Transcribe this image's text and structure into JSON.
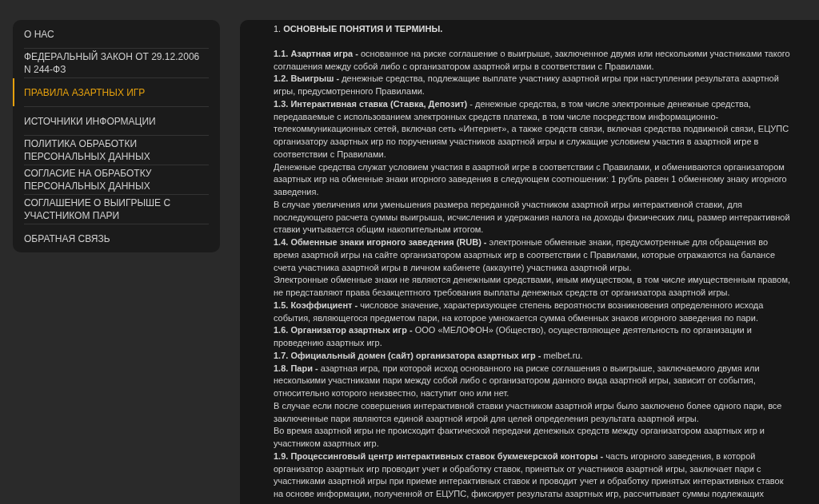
{
  "sidebar": {
    "items": [
      {
        "label": "О НАС",
        "selected": false
      },
      {
        "label": "ФЕДЕРАЛЬНЫЙ ЗАКОН ОТ 29.12.2006 N 244-ФЗ",
        "selected": false
      },
      {
        "label": "ПРАВИЛА АЗАРТНЫХ ИГР",
        "selected": true
      },
      {
        "label": "ИСТОЧНИКИ ИНФОРМАЦИИ",
        "selected": false
      },
      {
        "label": "ПОЛИТИКА ОБРАБОТКИ ПЕРСОНАЛЬНЫХ ДАННЫХ",
        "selected": false
      },
      {
        "label": "СОГЛАСИЕ НА ОБРАБОТКУ ПЕРСОНАЛЬНЫХ ДАННЫХ",
        "selected": false
      },
      {
        "label": "СОГЛАШЕНИЕ О ВЫИГРЫШЕ С УЧАСТНИКОМ ПАРИ",
        "selected": false
      },
      {
        "label": "ОБРАТНАЯ СВЯЗЬ",
        "selected": false
      }
    ]
  },
  "content": {
    "heading": "1. **ОСНОВНЫЕ ПОНЯТИЯ И ТЕРМИНЫ.**",
    "paragraphs": [
      "**1.1. Азартная игра -** основанное на риске соглашение о выигрыше, заключенное двумя или несколькими участниками такого соглашения между собой либо с организатором азартной игры в соответствии с Правилами.",
      "**1.2. Выигрыш -** денежные средства, подлежащие выплате участнику азартной игры при наступлении результата азартной игры, предусмотренного Правилами.",
      "**1.3. Интерактивная ставка (Ставка, Депозит)** - денежные средства, в том числе электронные денежные средства, передаваемые с использованием электронных средств платежа, в том числе посредством информационно-телекоммуникационных сетей, включая сеть «Интернет», а также средств связи, включая средства подвижной связи, ЕЦУПС организатору азартных игр по поручениям участников азартной игры и служащие условием участия в азартной игре в соответствии с Правилами.",
      "Денежные средства служат условием участия в азартной игре в соответствии с Правилами, и обмениваются организатором азартных игр на обменные знаки игорного заведения в следующем соотношении: 1 рубль равен 1 обменному знаку игорного заведения.",
      "В случае увеличения или уменьшения размера переданной участником азартной игры интерактивной ставки, для последующего расчета суммы выигрыша, исчисления и удержания налога на доходы физических лиц, размер интерактивной ставки учитывается общим накопительным итогом.",
      "**1.4. Обменные знаки игорного заведения (RUB) -** электронные обменные знаки, предусмотренные для обращения во время азартной игры на сайте организатором азартных игр в соответствии с Правилами, которые отражаются на балансе счета участника азартной игры в личном кабинете (аккаунте) участника азартной игры.",
      "Электронные обменные знаки не являются денежными средствами, иным имуществом, в том числе имущественным правом, не представляют права безакцептного требования выплаты денежных средств от организатора азартной игры.",
      "**1.5. Коэффициент -** числовое значение, характеризующее степень вероятности возникновения определенного исхода события, являющегося предметом пари, на которое умножается сумма обменных знаков игорного заведения по пари.",
      "**1.6. Организатор азартных игр -** ООО «МЕЛОФОН» (Общество), осуществляющее деятельность по организации и проведению азартных игр.",
      "**1.7. Официальный домен (сайт) организатора азартных игр -** melbet.ru.",
      "**1.8. Пари -** азартная игра, при которой исход основанного на риске соглашения о выигрыше, заключаемого двумя или несколькими участниками пари между собой либо с организатором данного вида азартной игры, зависит от события, относительно которого неизвестно, наступит оно или нет.",
      "В случае если после совершения интерактивной ставки участником азартной игры было заключено более одного пари, все заключенные пари являются единой азартной игрой для целей определения результата азартной игры.",
      "Во время азартной игры не происходит фактической передачи денежных средств между организатором азартных игр и участником азартных игр.",
      "**1.9. Процессинговый центр интерактивных ставок букмекерской конторы -** часть игорного заведения, в которой организатор азартных игр проводит учет и обработку ставок, принятых от участников азартной игры, заключает пари с участниками азартной игры при приеме интерактивных ставок и проводит учет и обработку принятых интерактивных ставок на основе информации, полученной от ЕЦУПС, фиксирует результаты азартных игр, рассчитывает суммы подлежащих"
    ]
  }
}
